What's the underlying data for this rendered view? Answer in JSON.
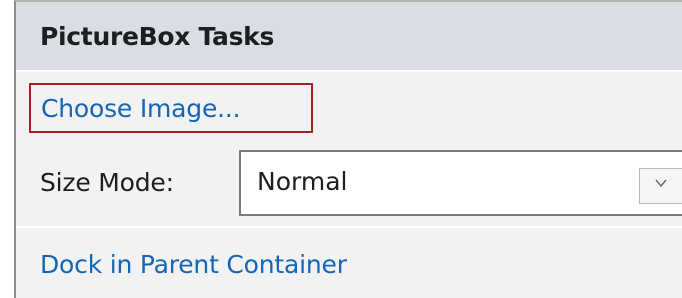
{
  "panel": {
    "title": "PictureBox Tasks",
    "choose_image_label": "Choose Image...",
    "size_mode": {
      "label": "Size Mode:",
      "selected": "Normal"
    },
    "dock_label": "Dock in Parent Container"
  },
  "icons": {
    "select_arrow": "chevron-down-icon"
  },
  "colors": {
    "link": "#1565b6",
    "highlight": "#a41f24",
    "header_bg": "#d9dde4",
    "panel_bg": "#f2f2f2"
  }
}
